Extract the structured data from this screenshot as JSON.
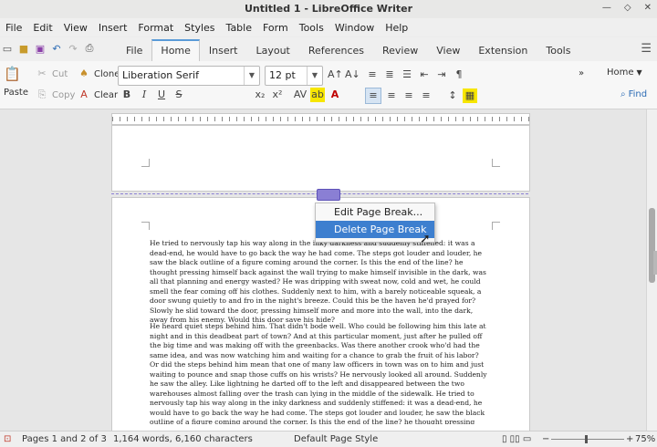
{
  "window": {
    "title": "Untitled 1 - LibreOffice Writer"
  },
  "menubar": [
    "File",
    "Edit",
    "View",
    "Insert",
    "Format",
    "Styles",
    "Table",
    "Form",
    "Tools",
    "Window",
    "Help"
  ],
  "tabs": [
    "File",
    "Home",
    "Insert",
    "Layout",
    "References",
    "Review",
    "View",
    "Extension",
    "Tools"
  ],
  "active_tab": "Home",
  "ribbon": {
    "paste": "Paste",
    "cut": "Cut",
    "copy": "Copy",
    "clone": "Clone",
    "clear": "Clear",
    "font_name": "Liberation Serif",
    "font_size": "12 pt",
    "style_name": "Home",
    "find": "Find"
  },
  "context_menu": {
    "items": [
      "Edit Page Break...",
      "Delete Page Break"
    ],
    "highlighted": "Delete Page Break"
  },
  "document": {
    "para1": "He tried to nervously tap his way along in the inky darkness and suddenly stiffened: it was a dead-end, he would have to go back the way he had come. The steps got louder and louder, he saw the black outline of a figure coming around the corner. Is this the end of the line? he thought pressing himself back against the wall trying to make himself invisible in the dark, was all that planning and energy wasted? He was dripping with sweat now, cold and wet, he could smell the fear coming off his clothes. Suddenly next to him, with a barely noticeable squeak, a door swung quietly to and fro in the night's breeze. Could this be the haven he'd prayed for? Slowly he slid toward the door, pressing himself more and more into the wall, into the dark, away from his enemy. Would this door save his hide?",
    "para2": "He heard quiet steps behind him. That didn't bode well. Who could be following him this late at night and in this deadbeat part of town? And at this particular moment, just after he pulled off the big time and was making off with the greenbacks. Was there another crook who'd had the same idea, and was now watching him and waiting for a chance to grab the fruit of his labor? Or did the steps behind him mean that one of many law officers in town was on to him and just waiting to pounce and snap those cuffs on his wrists? He nervously looked all around. Suddenly he saw the alley. Like lightning he darted off to the left and disappeared between the two warehouses almost falling over the trash can lying in the middle of the sidewalk. He tried to nervously tap his way along in the inky darkness and suddenly stiffened: it was a dead-end, he would have to go back the way he had come. The steps got louder and louder, he saw the black outline of a figure coming around the corner. Is this the end of the line? he thought pressing himself back against the wall trying to make himself invisible in the dark, was"
  },
  "status": {
    "pages": "Pages 1 and 2 of 3",
    "words": "1,164 words, 6,160 characters",
    "page_style": "Default Page Style",
    "zoom": "75%"
  }
}
